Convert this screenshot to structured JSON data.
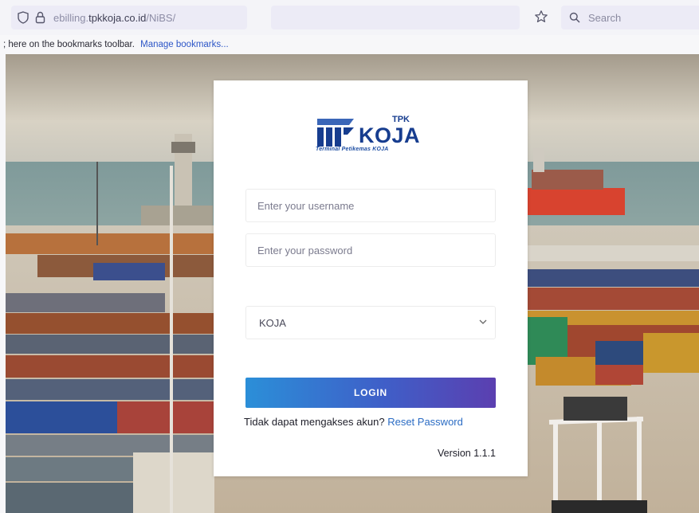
{
  "browser": {
    "url_prefix": "ebilling.",
    "url_domain": "tpkkoja.co.id",
    "url_path": "/NiBS/",
    "search_placeholder": "Search",
    "bookmarks_text": "; here on the bookmarks toolbar.",
    "bookmarks_link": "Manage bookmarks..."
  },
  "logo": {
    "small": "TPK",
    "word": "KOJA",
    "tagline": "Terminal Petikemas KOJA",
    "brand_color": "#173d8f"
  },
  "form": {
    "username_placeholder": "Enter your username",
    "password_placeholder": "Enter your password",
    "terminal_selected": "KOJA",
    "login_label": "LOGIN",
    "help_text": "Tidak dapat mengakses akun?",
    "reset_link": "Reset Password",
    "version": "Version 1.1.1"
  },
  "icons": {
    "shield": "shield-icon",
    "lock": "lock-icon",
    "star": "star-icon",
    "search": "search-icon",
    "dropdown": "chevron-down-icon"
  },
  "colors": {
    "button_gradient_start": "#2b8fd8",
    "button_gradient_end": "#5b3fb0",
    "link": "#2b6cc4"
  }
}
